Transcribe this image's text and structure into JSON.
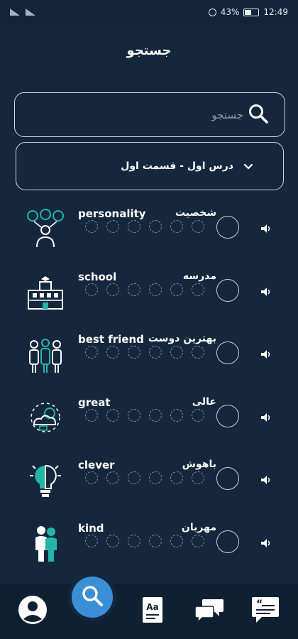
{
  "status_bar": {
    "battery": "43%",
    "time": "12:49"
  },
  "app_bar": {
    "title": "جستجو"
  },
  "search": {
    "placeholder": "جستجو"
  },
  "lesson_dropdown": {
    "selected": "درس اول - قسمت اول"
  },
  "words": [
    {
      "english": "personality",
      "persian": "شخصیت",
      "icon": "personality-icon"
    },
    {
      "english": "school",
      "persian": "مدرسه",
      "icon": "school-building-icon"
    },
    {
      "english": "best friend",
      "persian": "بهترین دوست",
      "icon": "friends-group-icon"
    },
    {
      "english": "great",
      "persian": "عالی",
      "icon": "cloud-sun-icon"
    },
    {
      "english": "clever",
      "persian": "باهوش",
      "icon": "lightbulb-icon"
    },
    {
      "english": "kind",
      "persian": "مهربان",
      "icon": "two-people-icon"
    }
  ],
  "bottom_nav": [
    {
      "name": "profile",
      "icon": "person-icon"
    },
    {
      "name": "search",
      "icon": "search-icon",
      "active": true
    },
    {
      "name": "dictionary",
      "icon": "aa-book-icon"
    },
    {
      "name": "chat",
      "icon": "chat-bubbles-icon"
    },
    {
      "name": "quotes",
      "icon": "quote-icon"
    }
  ],
  "colors": {
    "background": "#15273d",
    "accent": "#3a8fd6",
    "teal": "#23b5a8"
  }
}
